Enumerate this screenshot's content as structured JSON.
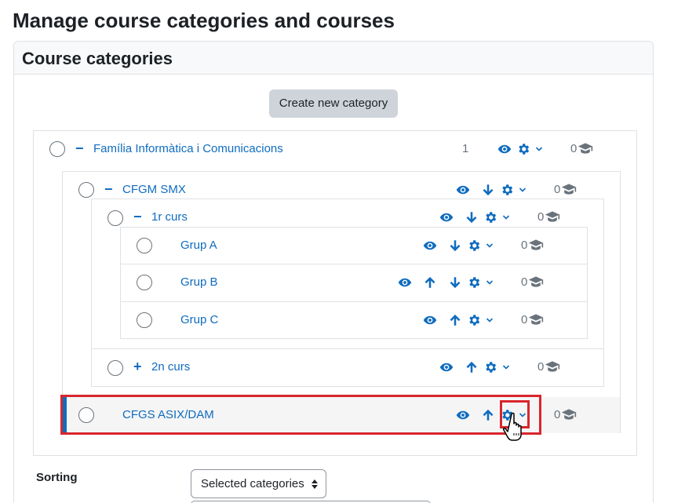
{
  "page": {
    "title": "Manage course categories and courses"
  },
  "card": {
    "title": "Course categories",
    "create_button": "Create new category"
  },
  "colors": {
    "link": "#0f6cbf",
    "highlight": "#d8262c"
  },
  "categories": [
    {
      "name": "Família Informàtica i Comunicacions",
      "toggle": "−",
      "count": "1",
      "courses": "0"
    },
    {
      "name": "CFGM SMX",
      "toggle": "−",
      "count": "",
      "courses": "0"
    },
    {
      "name": "1r curs",
      "toggle": "−",
      "count": "",
      "courses": "0"
    },
    {
      "name": "Grup A",
      "toggle": "",
      "count": "",
      "courses": "0"
    },
    {
      "name": "Grup B",
      "toggle": "",
      "count": "",
      "courses": "0"
    },
    {
      "name": "Grup C",
      "toggle": "",
      "count": "",
      "courses": "0"
    },
    {
      "name": "2n curs",
      "toggle": "+",
      "count": "",
      "courses": "0"
    },
    {
      "name": "CFGS ASIX/DAM",
      "toggle": "",
      "count": "",
      "courses": "0"
    }
  ],
  "sorting": {
    "label": "Sorting",
    "selected": "Selected categories"
  }
}
